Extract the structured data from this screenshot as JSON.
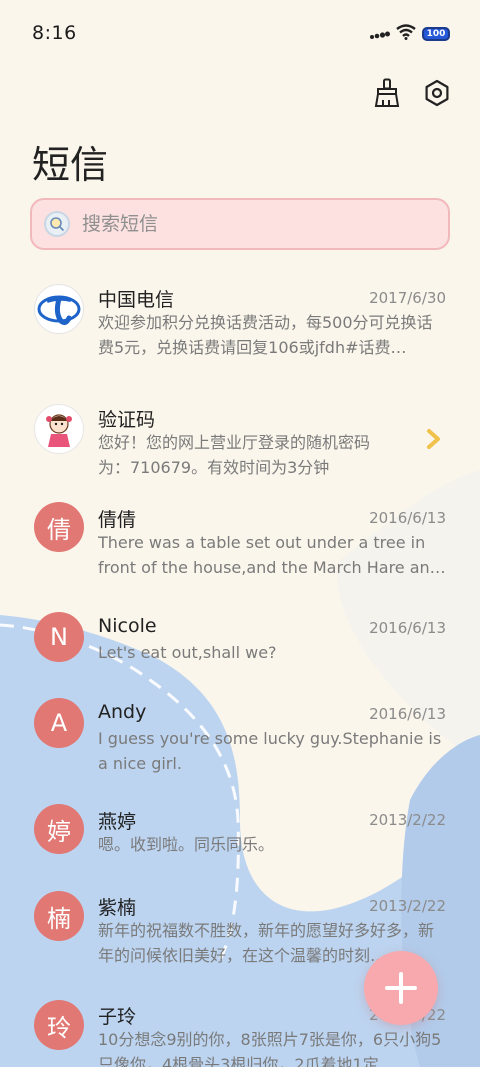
{
  "status_bar": {
    "time": "8:16",
    "battery": "100",
    "icons": [
      "signal-dots-icon",
      "wifi-icon",
      "battery-icon"
    ]
  },
  "toolbar": {
    "icons": [
      "broom-icon",
      "settings-gear-icon"
    ]
  },
  "page_title": "短信",
  "search": {
    "placeholder": "搜索短信",
    "icon": "search-mascot-icon"
  },
  "colors": {
    "background": "#fbf6ec",
    "wave_blue": "#bfd6f1",
    "avatar_red": "#e17873",
    "search_bg": "#fde1e1",
    "fab": "#f7a9ad",
    "chevron": "#f0c14b"
  },
  "messages": [
    {
      "name": "中国电信",
      "date": "2017/6/30",
      "preview": "欢迎参加积分兑换话费活动，每500分可兑换话费5元，兑换话费请回复106或jfdh#话费…",
      "avatar_type": "logo",
      "avatar_icon": "china-telecom-logo"
    },
    {
      "name": "验证码",
      "date": "",
      "preview": "您好！您的网上营业厅登录的随机密码为：710679。有效时间为3分钟",
      "avatar_type": "cartoon",
      "avatar_icon": "cartoon-girl-avatar"
    },
    {
      "name": "倩倩",
      "date": "2016/6/13",
      "preview": "There was a table set out under a tree in front of the house,and the March Hare an…",
      "avatar_type": "letter",
      "avatar_letter": "倩"
    },
    {
      "name": "Nicole",
      "date": "2016/6/13",
      "preview": "Let's eat out,shall we?",
      "avatar_type": "letter",
      "avatar_letter": "N"
    },
    {
      "name": "Andy",
      "date": "2016/6/13",
      "preview": "I guess you're some lucky guy.Stephanie is a nice girl.",
      "avatar_type": "letter",
      "avatar_letter": "A"
    },
    {
      "name": "燕婷",
      "date": "2013/2/22",
      "preview": "嗯。收到啦。同乐同乐。",
      "avatar_type": "letter",
      "avatar_letter": "婷"
    },
    {
      "name": "紫楠",
      "date": "2013/2/22",
      "preview": "新年的祝福数不胜数，新年的愿望好多好多，新年的问候依旧美好，在这个温馨的时刻…",
      "avatar_type": "letter",
      "avatar_letter": "楠"
    },
    {
      "name": "子玲",
      "date": "2013/2/22",
      "preview": "10分想念9别的你，8张照片7张是你，6只小狗5只像你，4根骨头3根归你，2爪着地1定…",
      "avatar_type": "letter",
      "avatar_letter": "玲"
    }
  ],
  "fab": {
    "icon": "plus-icon"
  }
}
